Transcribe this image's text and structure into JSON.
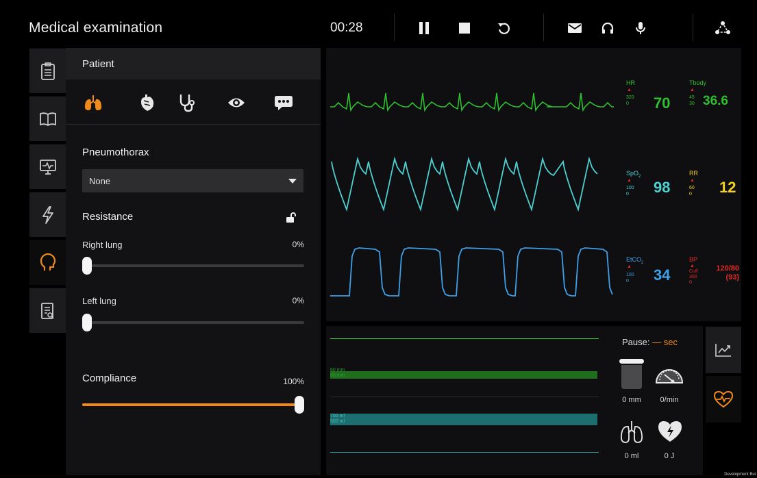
{
  "header": {
    "title": "Medical examination",
    "timer": "00:28",
    "controls": [
      "pause-icon",
      "stop-icon",
      "restart-icon",
      "message-icon",
      "headphones-icon",
      "microphone-icon",
      "network-icon"
    ]
  },
  "sidebar": {
    "tabs": [
      {
        "icon": "clipboard-icon",
        "active": false
      },
      {
        "icon": "book-icon",
        "active": false
      },
      {
        "icon": "monitor-icon",
        "active": false
      },
      {
        "icon": "lightning-icon",
        "active": false
      },
      {
        "icon": "head-icon",
        "active": true
      },
      {
        "icon": "report-search-icon",
        "active": false
      }
    ]
  },
  "patient_panel": {
    "title": "Patient",
    "organ_tabs": [
      {
        "icon": "lungs-icon",
        "active": true
      },
      {
        "icon": "heart-icon",
        "active": false
      },
      {
        "icon": "stethoscope-icon",
        "active": false
      },
      {
        "icon": "eye-icon",
        "active": false
      },
      {
        "icon": "chat-icon",
        "active": false
      }
    ],
    "pneumothorax": {
      "label": "Pneumothorax",
      "selected": "None"
    },
    "resistance": {
      "label": "Resistance",
      "right_lung": {
        "label": "Right lung",
        "value_text": "0%",
        "value": 0
      },
      "left_lung": {
        "label": "Left lung",
        "value_text": "0%",
        "value": 0
      }
    },
    "compliance": {
      "label": "Compliance",
      "value_text": "100%",
      "value": 100
    }
  },
  "vitals": {
    "hr": {
      "label": "HR",
      "limits": [
        "320",
        "0"
      ],
      "value": "70",
      "color": "#2fbf2f"
    },
    "tbody": {
      "label": "Tbody",
      "limits": [
        "45",
        "30"
      ],
      "value": "36.6",
      "color": "#2fbf2f"
    },
    "spo2": {
      "label": "SpO",
      "sub": "2",
      "limits": [
        "100",
        "0"
      ],
      "value": "98",
      "color": "#4dd0d0"
    },
    "rr": {
      "label": "RR",
      "limits": [
        "60",
        "0"
      ],
      "value": "12",
      "color": "#f0d020"
    },
    "etco2": {
      "label": "EtCO",
      "sub": "2",
      "limits": [
        "100",
        "0"
      ],
      "value": "34",
      "color": "#3fa0e8"
    },
    "bp": {
      "label": "BP",
      "limits": [
        "Cuff",
        "300",
        "0"
      ],
      "value_line1": "120/80",
      "value_line2": "(93)",
      "color": "#e02a2a"
    }
  },
  "respiration": {
    "band1_labels": [
      "60 mm",
      "60 mm"
    ],
    "band2_labels": [
      "700 ml",
      "500 ml"
    ],
    "pause": {
      "label": "Pause:",
      "dash": " — ",
      "unit": "sec"
    },
    "indicators": [
      {
        "icon": "container-icon",
        "caption": "0 mm"
      },
      {
        "icon": "gauge-icon",
        "caption": "0/min"
      },
      {
        "icon": "lungs-outline-icon",
        "caption": "0 ml"
      },
      {
        "icon": "heart-shock-icon",
        "caption": "0 J"
      }
    ]
  },
  "right_tabs": [
    {
      "icon": "trend-chart-icon",
      "active": false
    },
    {
      "icon": "heart-rate-icon",
      "active": true
    }
  ],
  "footer": {
    "note": "Development Bui"
  },
  "colors": {
    "accent": "#f08a1c",
    "ecg": "#2fbf2f",
    "pleth": "#4dd0d0",
    "capno": "#3fa0e8",
    "bp": "#e02a2a",
    "rr": "#f0d020"
  }
}
